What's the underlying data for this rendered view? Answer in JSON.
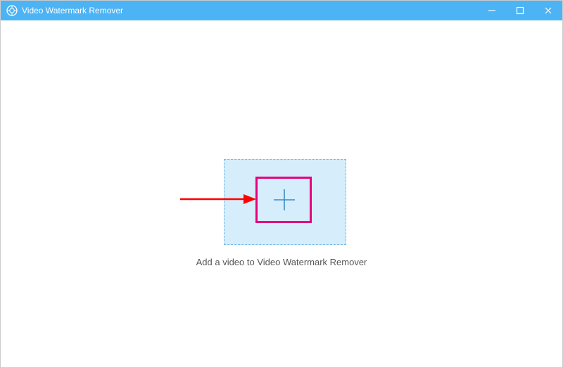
{
  "titlebar": {
    "app_name": "Video Watermark Remover"
  },
  "main": {
    "caption": "Add a video to Video Watermark Remover"
  },
  "icons": {
    "app": "app-logo",
    "minimize": "minimize-icon",
    "maximize": "maximize-icon",
    "close": "close-icon",
    "plus": "plus-icon"
  },
  "colors": {
    "titlebar_bg": "#4cb3f4",
    "dropzone_bg": "#d6edfb",
    "dropzone_border": "#6fb9e8",
    "highlight": "#e6007e",
    "arrow": "#ff0000",
    "plus": "#3a8cc4"
  }
}
